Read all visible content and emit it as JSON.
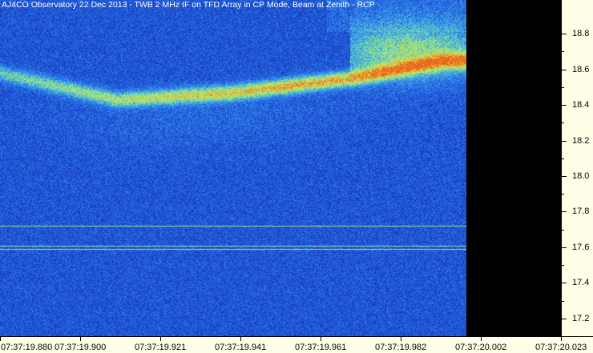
{
  "chart_data": {
    "type": "heatmap",
    "title": "AJ4CO Observatory 22 Dec 2013 - TWB 2 MHz IF on TFD Array in CP Mode, Beam at Zenith - RCP",
    "xlabel": "",
    "ylabel": "",
    "x_tick_labels": [
      "07:37:19.880",
      "07:37:19.900",
      "07:37:19.921",
      "07:37:19.941",
      "07:37:19.961",
      "07:37:19.982",
      "07:37:20.002",
      "07:37:20.023"
    ],
    "y_tick_labels": [
      "18.8",
      "18.6",
      "18.4",
      "18.2",
      "18.0",
      "17.8",
      "17.6",
      "17.4",
      "17.2"
    ],
    "y_ticks": [
      18.8,
      18.6,
      18.4,
      18.2,
      18.0,
      17.8,
      17.6,
      17.4,
      17.2
    ],
    "ylim": [
      17.1,
      18.99
    ],
    "colormap": [
      "#0a1f8a",
      "#1e4fd8",
      "#3aa0f0",
      "#8cf08c",
      "#f0d23c",
      "#e8641e"
    ],
    "background_color": "#0a1f8a",
    "no_data_color": "#000000",
    "features": [
      {
        "kind": "emission-band",
        "description_points": [
          [
            0.0,
            18.58
          ],
          [
            0.25,
            18.43
          ],
          [
            0.5,
            18.47
          ],
          [
            0.75,
            18.55
          ],
          [
            0.95,
            18.65
          ]
        ]
      },
      {
        "kind": "bright-patch",
        "x_range": [
          0.75,
          1.0
        ],
        "y_range": [
          18.55,
          18.85
        ]
      },
      {
        "kind": "interference-line",
        "y": 17.72
      },
      {
        "kind": "interference-line",
        "y": 17.61
      },
      {
        "kind": "interference-line",
        "y": 17.59
      }
    ]
  }
}
